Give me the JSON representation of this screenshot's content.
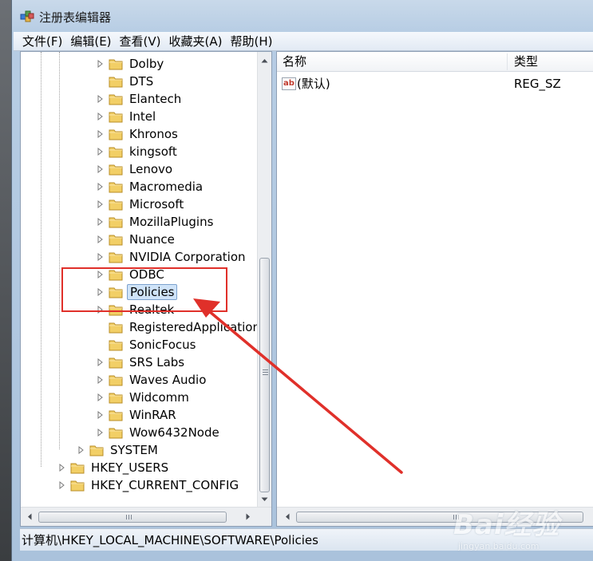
{
  "window": {
    "title": "注册表编辑器"
  },
  "menu": [
    "文件(F)",
    "编辑(E)",
    "查看(V)",
    "收藏夹(A)",
    "帮助(H)"
  ],
  "tree": {
    "software_children": [
      {
        "label": "Dolby",
        "expandable": true
      },
      {
        "label": "DTS",
        "expandable": false
      },
      {
        "label": "Elantech",
        "expandable": true
      },
      {
        "label": "Intel",
        "expandable": true
      },
      {
        "label": "Khronos",
        "expandable": true
      },
      {
        "label": "kingsoft",
        "expandable": true
      },
      {
        "label": "Lenovo",
        "expandable": true
      },
      {
        "label": "Macromedia",
        "expandable": true
      },
      {
        "label": "Microsoft",
        "expandable": true
      },
      {
        "label": "MozillaPlugins",
        "expandable": true
      },
      {
        "label": "Nuance",
        "expandable": true
      },
      {
        "label": "NVIDIA Corporation",
        "expandable": true
      },
      {
        "label": "ODBC",
        "expandable": true
      },
      {
        "label": "Policies",
        "expandable": true,
        "selected": true
      },
      {
        "label": "Realtek",
        "expandable": true
      },
      {
        "label": "RegisteredApplications",
        "expandable": false
      },
      {
        "label": "SonicFocus",
        "expandable": false
      },
      {
        "label": "SRS Labs",
        "expandable": true
      },
      {
        "label": "Waves Audio",
        "expandable": true
      },
      {
        "label": "Widcomm",
        "expandable": true
      },
      {
        "label": "WinRAR",
        "expandable": true
      },
      {
        "label": "Wow6432Node",
        "expandable": true
      }
    ],
    "system": "SYSTEM",
    "hkey_users": "HKEY_USERS",
    "hkey_current_config": "HKEY_CURRENT_CONFIG"
  },
  "list": {
    "columns": {
      "name": "名称",
      "type": "类型"
    },
    "rows": [
      {
        "name": "(默认)",
        "type": "REG_SZ"
      }
    ]
  },
  "status": {
    "path": "计算机\\HKEY_LOCAL_MACHINE\\SOFTWARE\\Policies"
  },
  "watermark": {
    "brand": "Bai经验",
    "url": "jingyan.baidu.com"
  },
  "colors": {
    "annotation": "#e0302a",
    "selection": "#cfe3f8"
  }
}
